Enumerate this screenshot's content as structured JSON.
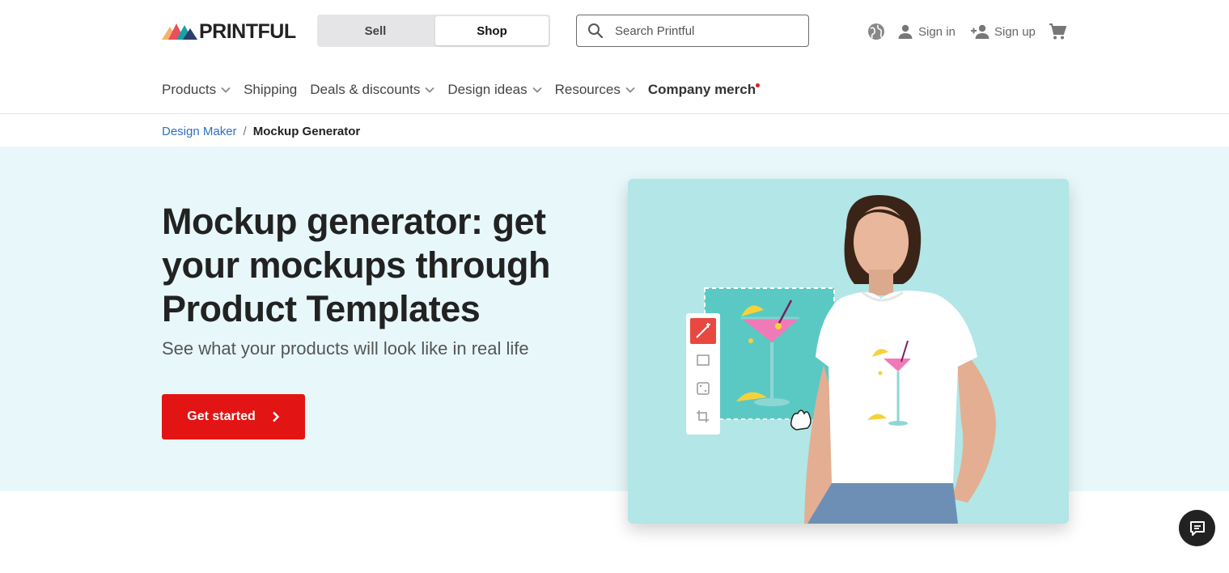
{
  "brand": {
    "name": "PRINTFUL"
  },
  "toggle": {
    "sell_label": "Sell",
    "shop_label": "Shop",
    "selected": "Shop"
  },
  "search": {
    "placeholder": "Search Printful"
  },
  "header_actions": {
    "language_icon": "globe-icon",
    "sign_in": "Sign in",
    "sign_up": "Sign up",
    "cart_icon": "cart-icon"
  },
  "nav": {
    "items": [
      {
        "label": "Products",
        "has_dropdown": true
      },
      {
        "label": "Shipping",
        "has_dropdown": false
      },
      {
        "label": "Deals & discounts",
        "has_dropdown": true
      },
      {
        "label": "Design ideas",
        "has_dropdown": true
      },
      {
        "label": "Resources",
        "has_dropdown": true
      }
    ],
    "highlight": {
      "label": "Company merch",
      "has_new_dot": true
    }
  },
  "breadcrumb": {
    "link": "Design Maker",
    "separator": "/",
    "current": "Mockup Generator"
  },
  "hero": {
    "title": "Mockup generator: get your mockups through Product Templates",
    "subtitle": "See what your products will look like in real life",
    "cta_label": "Get started"
  },
  "colors": {
    "accent": "#e31414",
    "hero_bg": "#e8f8fa",
    "card_bg": "#b3e6e6",
    "link": "#2e6fc6"
  }
}
